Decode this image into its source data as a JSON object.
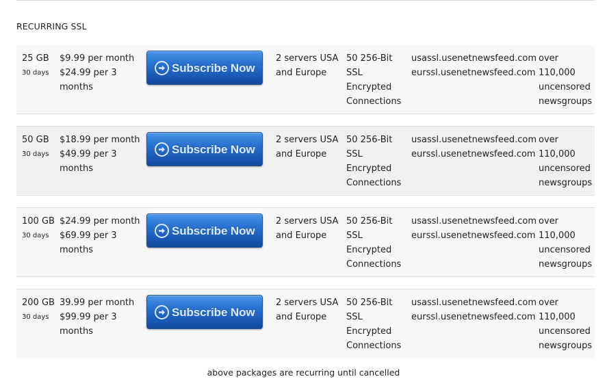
{
  "section": {
    "title": "RECURRING SSL"
  },
  "button": {
    "label": "Subscribe Now",
    "icon": "arrow-right-circle-icon"
  },
  "packages": [
    {
      "size": "25 GB",
      "duration": "30 days",
      "price_monthly": "$9.99 per month",
      "price_quarterly": "$24.99 per 3 months",
      "servers": "2 servers USA and Europe",
      "connections": "50 256-Bit SSL Encrypted Connections",
      "hosts": [
        "usassl.usenetnewsfeed.com",
        "eurssl.usenetnewsfeed.com"
      ],
      "newsgroups": "over 110,000 uncensored newsgroups"
    },
    {
      "size": "50 GB",
      "duration": "30 days",
      "price_monthly": "$18.99 per month",
      "price_quarterly": "$49.99 per 3 months",
      "servers": "2 servers USA and Europe",
      "connections": "50 256-Bit SSL Encrypted Connections",
      "hosts": [
        "usassl.usenetnewsfeed.com",
        "eurssl.usenetnewsfeed.com"
      ],
      "newsgroups": "over 110,000 uncensored newsgroups"
    },
    {
      "size": "100 GB",
      "duration": "30 days",
      "price_monthly": "$24.99 per month",
      "price_quarterly": "$69.99 per 3 months",
      "servers": "2 servers USA and Europe",
      "connections": "50 256-Bit SSL Encrypted Connections",
      "hosts": [
        "usassl.usenetnewsfeed.com",
        "eurssl.usenetnewsfeed.com"
      ],
      "newsgroups": "over 110,000 uncensored newsgroups"
    },
    {
      "size": "200 GB",
      "duration": "30 days",
      "price_monthly": "39.99 per month",
      "price_quarterly": "$99.99 per 3 months",
      "servers": "2 servers USA and Europe",
      "connections": "50 256-Bit SSL Encrypted Connections",
      "hosts": [
        "usassl.usenetnewsfeed.com",
        "eurssl.usenetnewsfeed.com"
      ],
      "newsgroups": "over 110,000 uncensored newsgroups"
    }
  ],
  "footnote": "above packages are recurring until cancelled",
  "colors": {
    "button_top": "#4a94e8",
    "button_bottom": "#144a9c",
    "button_text": "#dbe9fb",
    "row_bg_light": "#f7f7f7",
    "row_bg_dark": "#f1f1f1",
    "divider": "#dedede"
  }
}
